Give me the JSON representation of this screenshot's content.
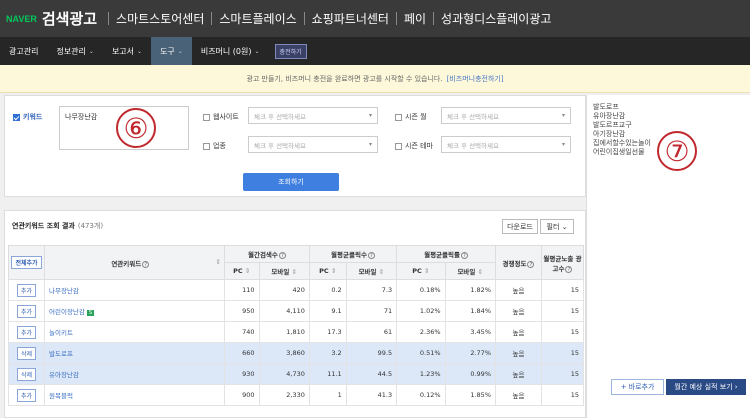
{
  "topbar": {
    "naver": "NAVER",
    "title": "검색광고",
    "services": [
      "스마트스토어센터",
      "스마트플레이스",
      "쇼핑파트너센터",
      "페이",
      "성과형디스플레이광고"
    ]
  },
  "nav": {
    "items": [
      {
        "label": "광고관리",
        "dd": ""
      },
      {
        "label": "정보관리",
        "dd": "⌄"
      },
      {
        "label": "보고서",
        "dd": "⌄"
      },
      {
        "label": "도구",
        "dd": "⌄"
      },
      {
        "label": "비즈머니 (0원)",
        "dd": "⌄"
      }
    ],
    "charge": "충전하기"
  },
  "notice": {
    "text": "광고 만들기, 비즈머니 충전을 완료하면 광고를 시작할 수 있습니다.",
    "link": "[비즈머니충전하기]"
  },
  "filters": {
    "keyword_label": "키워드",
    "keyword_value": "나무장난감",
    "website_label": "웹사이트",
    "industry_label": "업종",
    "season_month_label": "시즌 월",
    "season_theme_label": "시즌 테마",
    "select_placeholder": "체크 후 선택하세요",
    "search_btn": "조회하기"
  },
  "annot": {
    "six": "⑥",
    "seven": "⑦"
  },
  "results": {
    "title": "연관키워드 조회 결과",
    "count": "(473개)",
    "download": "다운로드",
    "filter": "필터 ⌄",
    "add_all": "전체추가",
    "headers": {
      "kw": "연관키워드",
      "monthly": "월간검색수",
      "avg_clicks": "월평균클릭수",
      "avg_ctr": "월평균클릭률",
      "competition": "경쟁정도",
      "ad_count": "월평균노출 광고수",
      "pc": "PC",
      "mobile": "모바일",
      "q": "?",
      "sort": "⇕"
    },
    "rows": [
      {
        "btn": "추가",
        "kw": "나무장난감",
        "badge": "",
        "v": [
          "110",
          "420",
          "0.2",
          "7.3",
          "0.18%",
          "1.82%",
          "높음",
          "15"
        ],
        "hl": false
      },
      {
        "btn": "추가",
        "kw": "어린이장난감",
        "badge": "S",
        "v": [
          "950",
          "4,110",
          "9.1",
          "71",
          "1.02%",
          "1.84%",
          "높음",
          "15"
        ],
        "hl": false
      },
      {
        "btn": "추가",
        "kw": "놀이키트",
        "badge": "",
        "v": [
          "740",
          "1,810",
          "17.3",
          "61",
          "2.36%",
          "3.45%",
          "높음",
          "15"
        ],
        "hl": false
      },
      {
        "btn": "삭제",
        "kw": "발도로프",
        "badge": "",
        "v": [
          "660",
          "3,860",
          "3.2",
          "99.5",
          "0.51%",
          "2.77%",
          "높음",
          "15"
        ],
        "hl": true
      },
      {
        "btn": "삭제",
        "kw": "유아장난감",
        "badge": "",
        "v": [
          "930",
          "4,730",
          "11.1",
          "44.5",
          "1.23%",
          "0.99%",
          "높음",
          "15"
        ],
        "hl": true
      },
      {
        "btn": "추가",
        "kw": "원목블럭",
        "badge": "",
        "v": [
          "900",
          "2,330",
          "1",
          "41.3",
          "0.12%",
          "1.85%",
          "높음",
          "15"
        ],
        "hl": false
      }
    ]
  },
  "sidebar": {
    "items": [
      "발도로프",
      "유아장난감",
      "발도르프교구",
      "아기장난감",
      "집에서할수있는놀이",
      "어린이집생일선물"
    ],
    "add_btn": "+ 바로추가",
    "est_btn": "월간 예상 실적 보기 ›"
  }
}
